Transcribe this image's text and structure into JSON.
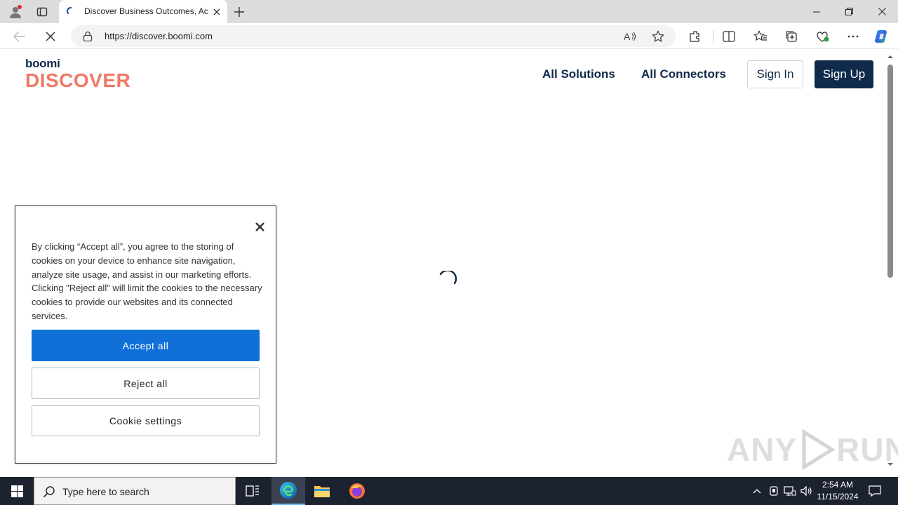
{
  "browser": {
    "tab_title": "Discover Business Outcomes, Accelerators",
    "url": "https://discover.boomi.com"
  },
  "site": {
    "logo_top": "boomi",
    "logo_bottom": "DISCOVER",
    "nav": {
      "all_solutions": "All Solutions",
      "all_connectors": "All Connectors",
      "sign_in": "Sign In",
      "sign_up": "Sign Up"
    },
    "brand_color": "#0f2a4a",
    "logo_accent_color": "#f07a64"
  },
  "cookie_banner": {
    "text": "By clicking “Accept all”, you agree to the storing of cookies on your device to enhance site navigation, analyze site usage, and assist in our marketing efforts. Clicking \"Reject all\" will limit the cookies to the necessary cookies to provide our websites and its connected services.",
    "accept_label": "Accept all",
    "reject_label": "Reject all",
    "settings_label": "Cookie settings",
    "accept_color": "#1070d8"
  },
  "taskbar": {
    "search_placeholder": "Type here to search",
    "time": "2:54 AM",
    "date": "11/15/2024"
  },
  "watermark": {
    "left": "ANY",
    "right": "RUN"
  }
}
